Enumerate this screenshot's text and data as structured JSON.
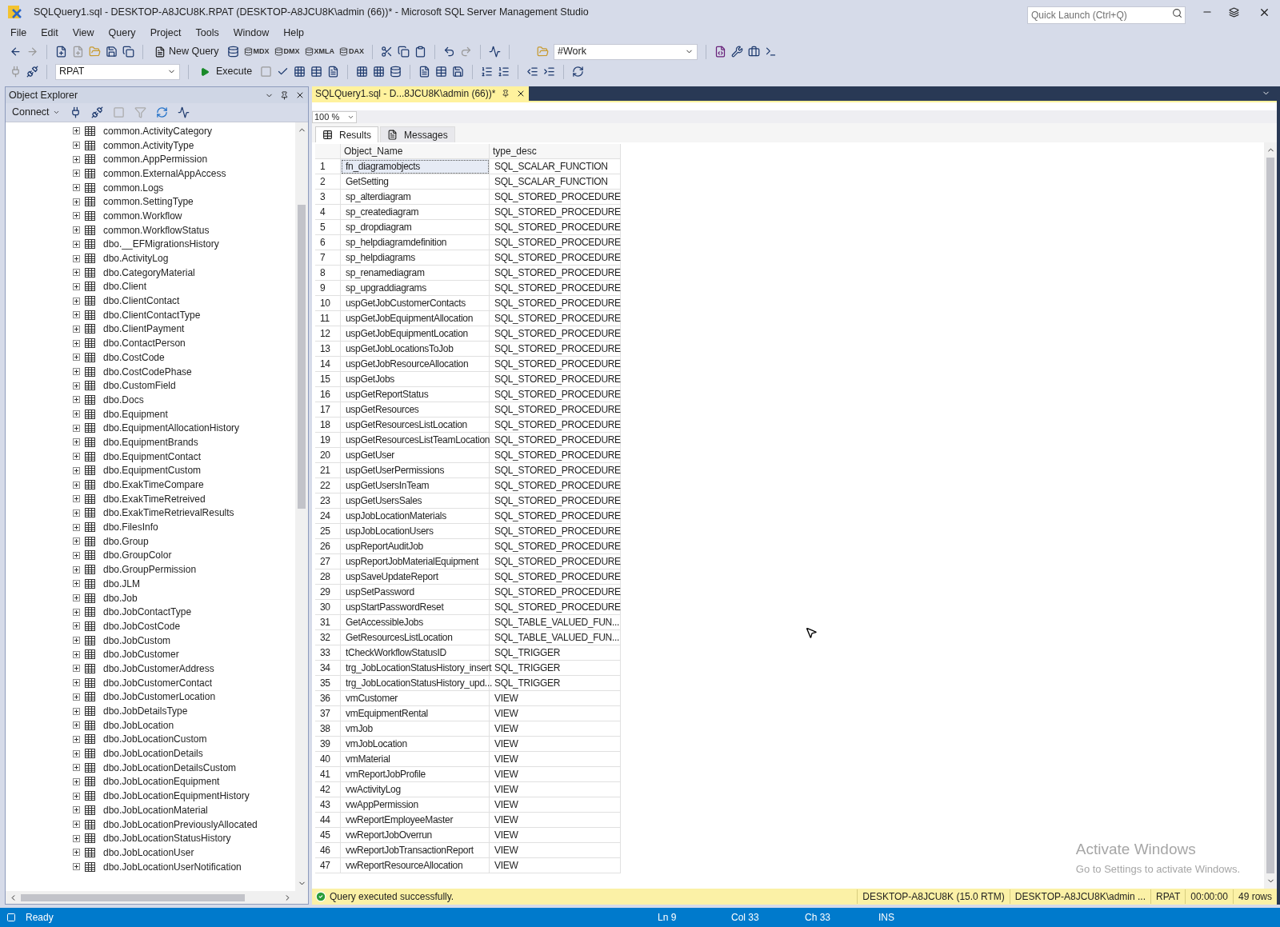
{
  "window": {
    "title": "SQLQuery1.sql - DESKTOP-A8JCU8K.RPAT (DESKTOP-A8JCU8K\\admin (66))* - Microsoft SQL Server Management Studio",
    "quick_launch": {
      "placeholder": "Quick Launch (Ctrl+Q)"
    }
  },
  "menu": [
    "File",
    "Edit",
    "View",
    "Query",
    "Project",
    "Tools",
    "Window",
    "Help"
  ],
  "toolbar": {
    "new_query": "New Query",
    "query_types": [
      "MDX",
      "DMX",
      "XMLA",
      "DAX"
    ],
    "solution_config": "#Work",
    "database": "RPAT",
    "execute": "Execute"
  },
  "object_explorer": {
    "title": "Object Explorer",
    "connect": "Connect",
    "items": [
      "common.ActivityCategory",
      "common.ActivityType",
      "common.AppPermission",
      "common.ExternalAppAccess",
      "common.Logs",
      "common.SettingType",
      "common.Workflow",
      "common.WorkflowStatus",
      "dbo.__EFMigrationsHistory",
      "dbo.ActivityLog",
      "dbo.CategoryMaterial",
      "dbo.Client",
      "dbo.ClientContact",
      "dbo.ClientContactType",
      "dbo.ClientPayment",
      "dbo.ContactPerson",
      "dbo.CostCode",
      "dbo.CostCodePhase",
      "dbo.CustomField",
      "dbo.Docs",
      "dbo.Equipment",
      "dbo.EquipmentAllocationHistory",
      "dbo.EquipmentBrands",
      "dbo.EquipmentContact",
      "dbo.EquipmentCustom",
      "dbo.ExakTimeCompare",
      "dbo.ExakTimeRetreived",
      "dbo.ExakTimeRetrievalResults",
      "dbo.FilesInfo",
      "dbo.Group",
      "dbo.GroupColor",
      "dbo.GroupPermission",
      "dbo.JLM",
      "dbo.Job",
      "dbo.JobContactType",
      "dbo.JobCostCode",
      "dbo.JobCustom",
      "dbo.JobCustomer",
      "dbo.JobCustomerAddress",
      "dbo.JobCustomerContact",
      "dbo.JobCustomerLocation",
      "dbo.JobDetailsType",
      "dbo.JobLocation",
      "dbo.JobLocationCustom",
      "dbo.JobLocationDetails",
      "dbo.JobLocationDetailsCustom",
      "dbo.JobLocationEquipment",
      "dbo.JobLocationEquipmentHistory",
      "dbo.JobLocationMaterial",
      "dbo.JobLocationPreviouslyAllocated",
      "dbo.JobLocationStatusHistory",
      "dbo.JobLocationUser",
      "dbo.JobLocationUserNotification"
    ]
  },
  "document_tab": {
    "title": "SQLQuery1.sql - D...8JCU8K\\admin (66))*",
    "selected": true
  },
  "zoom": "100 %",
  "result_tabs": [
    {
      "label": "Results",
      "selected": true
    },
    {
      "label": "Messages",
      "selected": false
    }
  ],
  "grid": {
    "columns": [
      "Object_Name",
      "type_desc"
    ],
    "rows": [
      {
        "n": "1",
        "name": "fn_diagramobjects",
        "type": "SQL_SCALAR_FUNCTION",
        "selected": true
      },
      {
        "n": "2",
        "name": "GetSetting",
        "type": "SQL_SCALAR_FUNCTION",
        "selected": false
      },
      {
        "n": "3",
        "name": "sp_alterdiagram",
        "type": "SQL_STORED_PROCEDURE",
        "selected": false
      },
      {
        "n": "4",
        "name": "sp_creatediagram",
        "type": "SQL_STORED_PROCEDURE",
        "selected": false
      },
      {
        "n": "5",
        "name": "sp_dropdiagram",
        "type": "SQL_STORED_PROCEDURE",
        "selected": false
      },
      {
        "n": "6",
        "name": "sp_helpdiagramdefinition",
        "type": "SQL_STORED_PROCEDURE",
        "selected": false
      },
      {
        "n": "7",
        "name": "sp_helpdiagrams",
        "type": "SQL_STORED_PROCEDURE",
        "selected": false
      },
      {
        "n": "8",
        "name": "sp_renamediagram",
        "type": "SQL_STORED_PROCEDURE",
        "selected": false
      },
      {
        "n": "9",
        "name": "sp_upgraddiagrams",
        "type": "SQL_STORED_PROCEDURE",
        "selected": false
      },
      {
        "n": "10",
        "name": "uspGetJobCustomerContacts",
        "type": "SQL_STORED_PROCEDURE",
        "selected": false
      },
      {
        "n": "11",
        "name": "uspGetJobEquipmentAllocation",
        "type": "SQL_STORED_PROCEDURE",
        "selected": false
      },
      {
        "n": "12",
        "name": "uspGetJobEquipmentLocation",
        "type": "SQL_STORED_PROCEDURE",
        "selected": false
      },
      {
        "n": "13",
        "name": "uspGetJobLocationsToJob",
        "type": "SQL_STORED_PROCEDURE",
        "selected": false
      },
      {
        "n": "14",
        "name": "uspGetJobResourceAllocation",
        "type": "SQL_STORED_PROCEDURE",
        "selected": false
      },
      {
        "n": "15",
        "name": "uspGetJobs",
        "type": "SQL_STORED_PROCEDURE",
        "selected": false
      },
      {
        "n": "16",
        "name": "uspGetReportStatus",
        "type": "SQL_STORED_PROCEDURE",
        "selected": false
      },
      {
        "n": "17",
        "name": "uspGetResources",
        "type": "SQL_STORED_PROCEDURE",
        "selected": false
      },
      {
        "n": "18",
        "name": "uspGetResourcesListLocation",
        "type": "SQL_STORED_PROCEDURE",
        "selected": false
      },
      {
        "n": "19",
        "name": "uspGetResourcesListTeamLocation",
        "type": "SQL_STORED_PROCEDURE",
        "selected": false
      },
      {
        "n": "20",
        "name": "uspGetUser",
        "type": "SQL_STORED_PROCEDURE",
        "selected": false
      },
      {
        "n": "21",
        "name": "uspGetUserPermissions",
        "type": "SQL_STORED_PROCEDURE",
        "selected": false
      },
      {
        "n": "22",
        "name": "uspGetUsersInTeam",
        "type": "SQL_STORED_PROCEDURE",
        "selected": false
      },
      {
        "n": "23",
        "name": "uspGetUsersSales",
        "type": "SQL_STORED_PROCEDURE",
        "selected": false
      },
      {
        "n": "24",
        "name": "uspJobLocationMaterials",
        "type": "SQL_STORED_PROCEDURE",
        "selected": false
      },
      {
        "n": "25",
        "name": "uspJobLocationUsers",
        "type": "SQL_STORED_PROCEDURE",
        "selected": false
      },
      {
        "n": "26",
        "name": "uspReportAuditJob",
        "type": "SQL_STORED_PROCEDURE",
        "selected": false
      },
      {
        "n": "27",
        "name": "uspReportJobMaterialEquipment",
        "type": "SQL_STORED_PROCEDURE",
        "selected": false
      },
      {
        "n": "28",
        "name": "uspSaveUpdateReport",
        "type": "SQL_STORED_PROCEDURE",
        "selected": false
      },
      {
        "n": "29",
        "name": "uspSetPassword",
        "type": "SQL_STORED_PROCEDURE",
        "selected": false
      },
      {
        "n": "30",
        "name": "uspStartPasswordReset",
        "type": "SQL_STORED_PROCEDURE",
        "selected": false
      },
      {
        "n": "31",
        "name": "GetAccessibleJobs",
        "type": "SQL_TABLE_VALUED_FUN...",
        "selected": false
      },
      {
        "n": "32",
        "name": "GetResourcesListLocation",
        "type": "SQL_TABLE_VALUED_FUN...",
        "selected": false
      },
      {
        "n": "33",
        "name": "tCheckWorkflowStatusID",
        "type": "SQL_TRIGGER",
        "selected": false
      },
      {
        "n": "34",
        "name": "trg_JobLocationStatusHistory_insert",
        "type": "SQL_TRIGGER",
        "selected": false
      },
      {
        "n": "35",
        "name": "trg_JobLocationStatusHistory_upd...",
        "type": "SQL_TRIGGER",
        "selected": false
      },
      {
        "n": "36",
        "name": "vmCustomer",
        "type": "VIEW",
        "selected": false
      },
      {
        "n": "37",
        "name": "vmEquipmentRental",
        "type": "VIEW",
        "selected": false
      },
      {
        "n": "38",
        "name": "vmJob",
        "type": "VIEW",
        "selected": false
      },
      {
        "n": "39",
        "name": "vmJobLocation",
        "type": "VIEW",
        "selected": false
      },
      {
        "n": "40",
        "name": "vmMaterial",
        "type": "VIEW",
        "selected": false
      },
      {
        "n": "41",
        "name": "vmReportJobProfile",
        "type": "VIEW",
        "selected": false
      },
      {
        "n": "42",
        "name": "vwActivityLog",
        "type": "VIEW",
        "selected": false
      },
      {
        "n": "43",
        "name": "vwAppPermission",
        "type": "VIEW",
        "selected": false
      },
      {
        "n": "44",
        "name": "vwReportEmployeeMaster",
        "type": "VIEW",
        "selected": false
      },
      {
        "n": "45",
        "name": "vwReportJobOverrun",
        "type": "VIEW",
        "selected": false
      },
      {
        "n": "46",
        "name": "vwReportJobTransactionReport",
        "type": "VIEW",
        "selected": false
      },
      {
        "n": "47",
        "name": "vwReportResourceAllocation",
        "type": "VIEW",
        "selected": false
      }
    ]
  },
  "query_status": {
    "message": "Query executed successfully.",
    "cells": [
      "DESKTOP-A8JCU8K (15.0 RTM)",
      "DESKTOP-A8JCU8K\\admin ...",
      "RPAT",
      "00:00:00",
      "49 rows"
    ]
  },
  "activation": {
    "title": "Activate Windows",
    "hint": "Go to Settings to activate Windows."
  },
  "status_bar": {
    "state": "Ready",
    "fields": [
      "Ln 9",
      "Col 33",
      "Ch 33",
      "INS"
    ]
  }
}
